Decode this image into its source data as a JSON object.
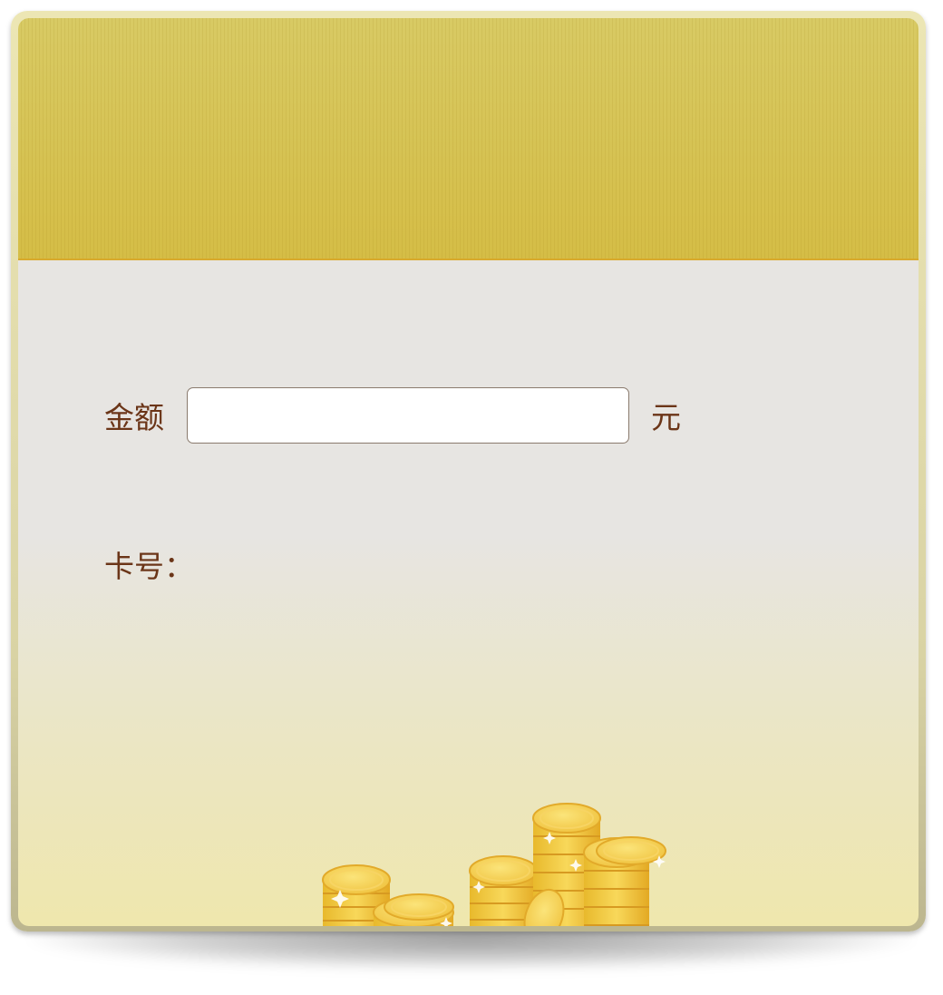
{
  "form": {
    "amount_label": "金额",
    "amount_value": "",
    "amount_placeholder": "",
    "amount_unit": "元",
    "card_label": "卡号：",
    "card_value": ""
  },
  "colors": {
    "header": "#d6c24e",
    "header_border": "#d8a92c",
    "body": "#e7e5e2",
    "text": "#6b3518",
    "frame": "#e3dca9"
  },
  "decoration": {
    "coins": "gold-coin-stacks-illustration"
  }
}
